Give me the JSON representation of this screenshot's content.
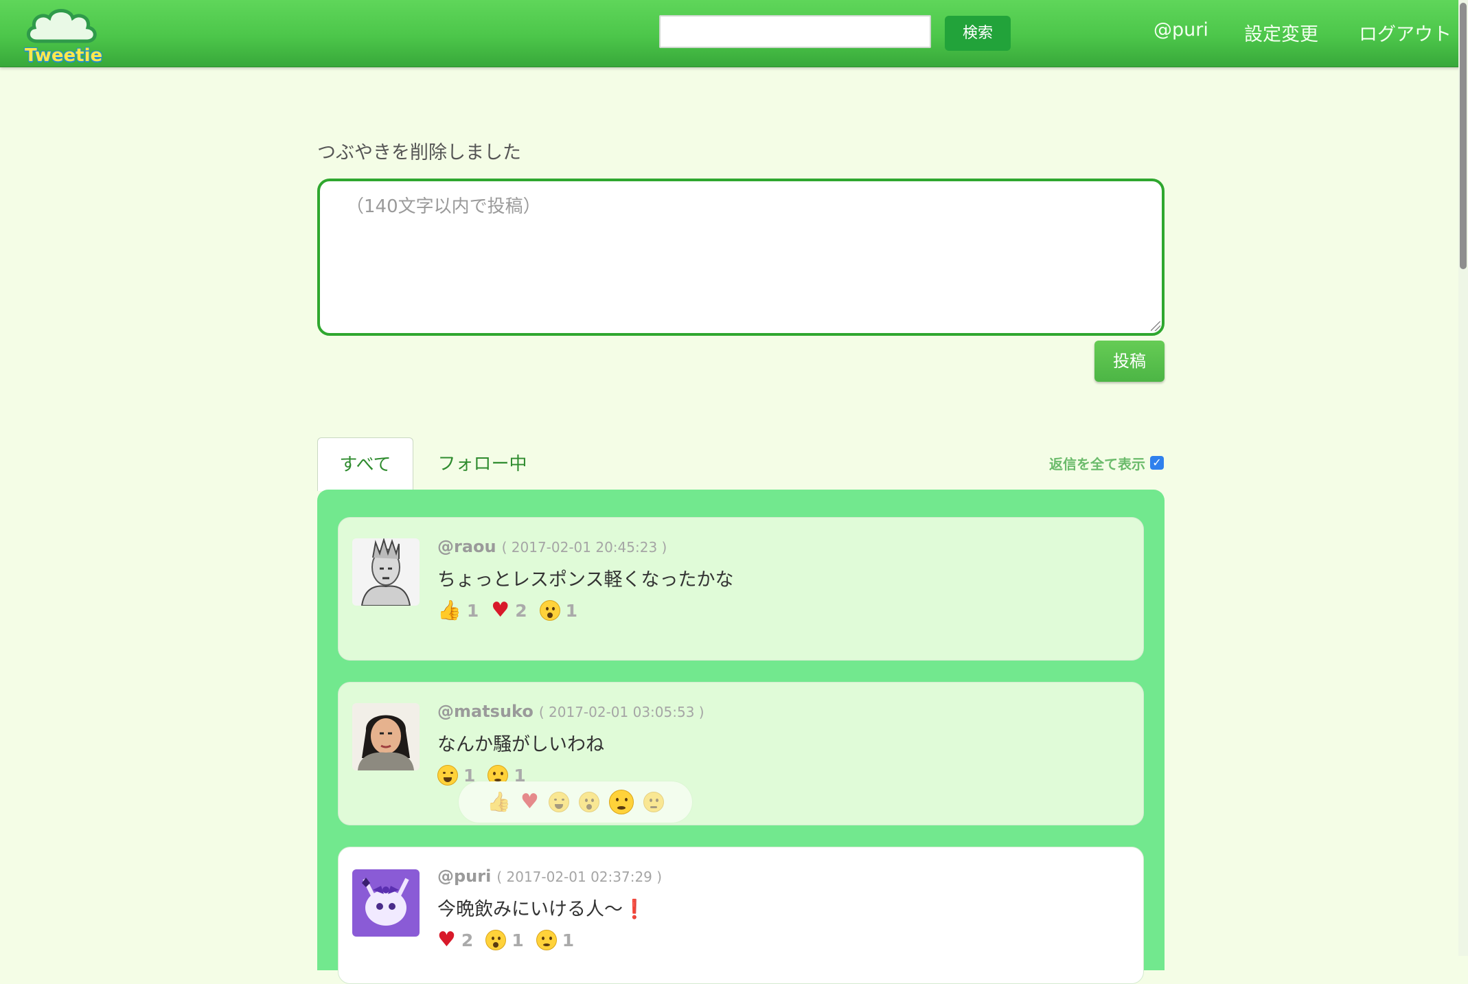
{
  "header": {
    "logo_text": "Tweetie",
    "search_placeholder": "",
    "search_button": "検索",
    "nav": [
      "@puri",
      "設定変更",
      "ログアウト"
    ]
  },
  "flash_message": "つぶやきを削除しました",
  "composer": {
    "placeholder": "（140文字以内で投稿）",
    "post_button": "投稿"
  },
  "tabs": [
    "すべて",
    "フォロー中"
  ],
  "show_all_replies_label": "返信を全て表示",
  "show_all_replies_checked": true,
  "tweets": [
    {
      "handle": "@raou",
      "timestamp": "( 2017-02-01 20:45:23 )",
      "text": "ちょっとレスポンス軽くなったかな",
      "reactions": [
        {
          "icon": "thumbs-up-icon",
          "count": "1"
        },
        {
          "icon": "heart-icon",
          "count": "2"
        },
        {
          "icon": "surprised-face-icon",
          "count": "1"
        }
      ]
    },
    {
      "handle": "@matsuko",
      "timestamp": "( 2017-02-01 03:05:53 )",
      "text": "なんか騒がしいわね",
      "reactions": [
        {
          "icon": "laughing-face-icon",
          "count": "1"
        },
        {
          "icon": "crying-face-icon",
          "count": "1"
        }
      ]
    },
    {
      "handle": "@puri",
      "timestamp": "( 2017-02-01 02:37:29 )",
      "text": "今晩飲みにいける人〜",
      "text_suffix": "❗",
      "reactions": [
        {
          "icon": "heart-icon",
          "count": "2"
        },
        {
          "icon": "surprised-face-icon",
          "count": "1"
        },
        {
          "icon": "crying-face-icon",
          "count": "1"
        }
      ]
    }
  ],
  "reaction_picker": [
    "thumbs-up-icon",
    "heart-icon",
    "laughing-face-icon",
    "surprised-face-icon",
    "crying-face-icon",
    "angry-face-icon"
  ],
  "colors": {
    "header_green": "#4cc64a",
    "timeline_green": "#72e88e",
    "page_background": "#f4fde6"
  }
}
